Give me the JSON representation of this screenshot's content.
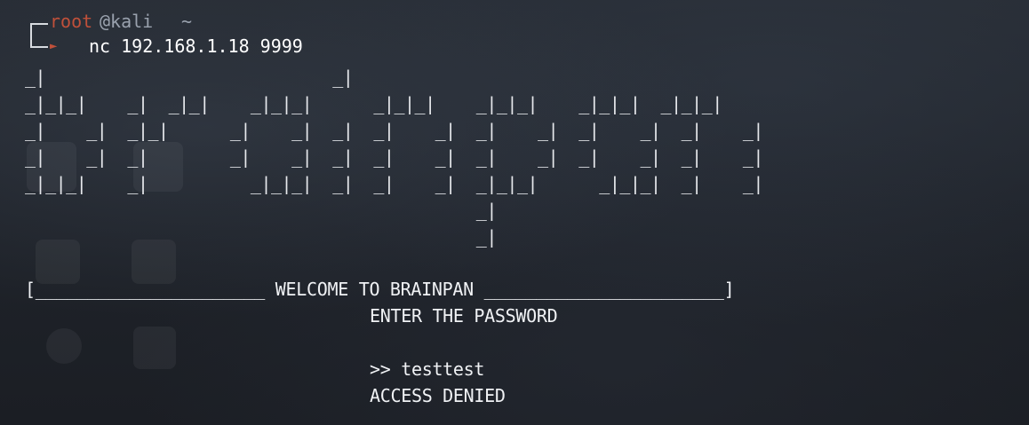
{
  "window": {
    "background_color": "#1f232a",
    "text_color": "#e6e8ec",
    "accent_color": "#c0503a"
  },
  "prompt": {
    "user": "root",
    "host": "@kali",
    "cwd": "~",
    "arrow_icon": "prompt-arrow-icon",
    "command": "nc 192.168.1.18 9999"
  },
  "banner": {
    "ascii_art_lines": [
      "_|                            _|",
      "_|_|_|    _|  _|_|    _|_|_|      _|_|_|    _|_|_|    _|_|_|  _|_|_|",
      "_|    _|  _|_|      _|    _|  _|  _|    _|  _|    _|  _|    _|  _|    _|",
      "_|    _|  _|        _|    _|  _|  _|    _|  _|    _|  _|    _|  _|    _|",
      "_|_|_|    _|          _|_|_|  _|  _|    _|  _|_|_|      _|_|_|  _|    _|",
      "                                            _|",
      "                                            _|"
    ]
  },
  "session": {
    "welcome_line": "[______________________ WELCOME TO BRAINPAN _______________________]",
    "password_prompt": "ENTER THE PASSWORD",
    "input_line": ">> testtest",
    "result": "ACCESS DENIED"
  }
}
